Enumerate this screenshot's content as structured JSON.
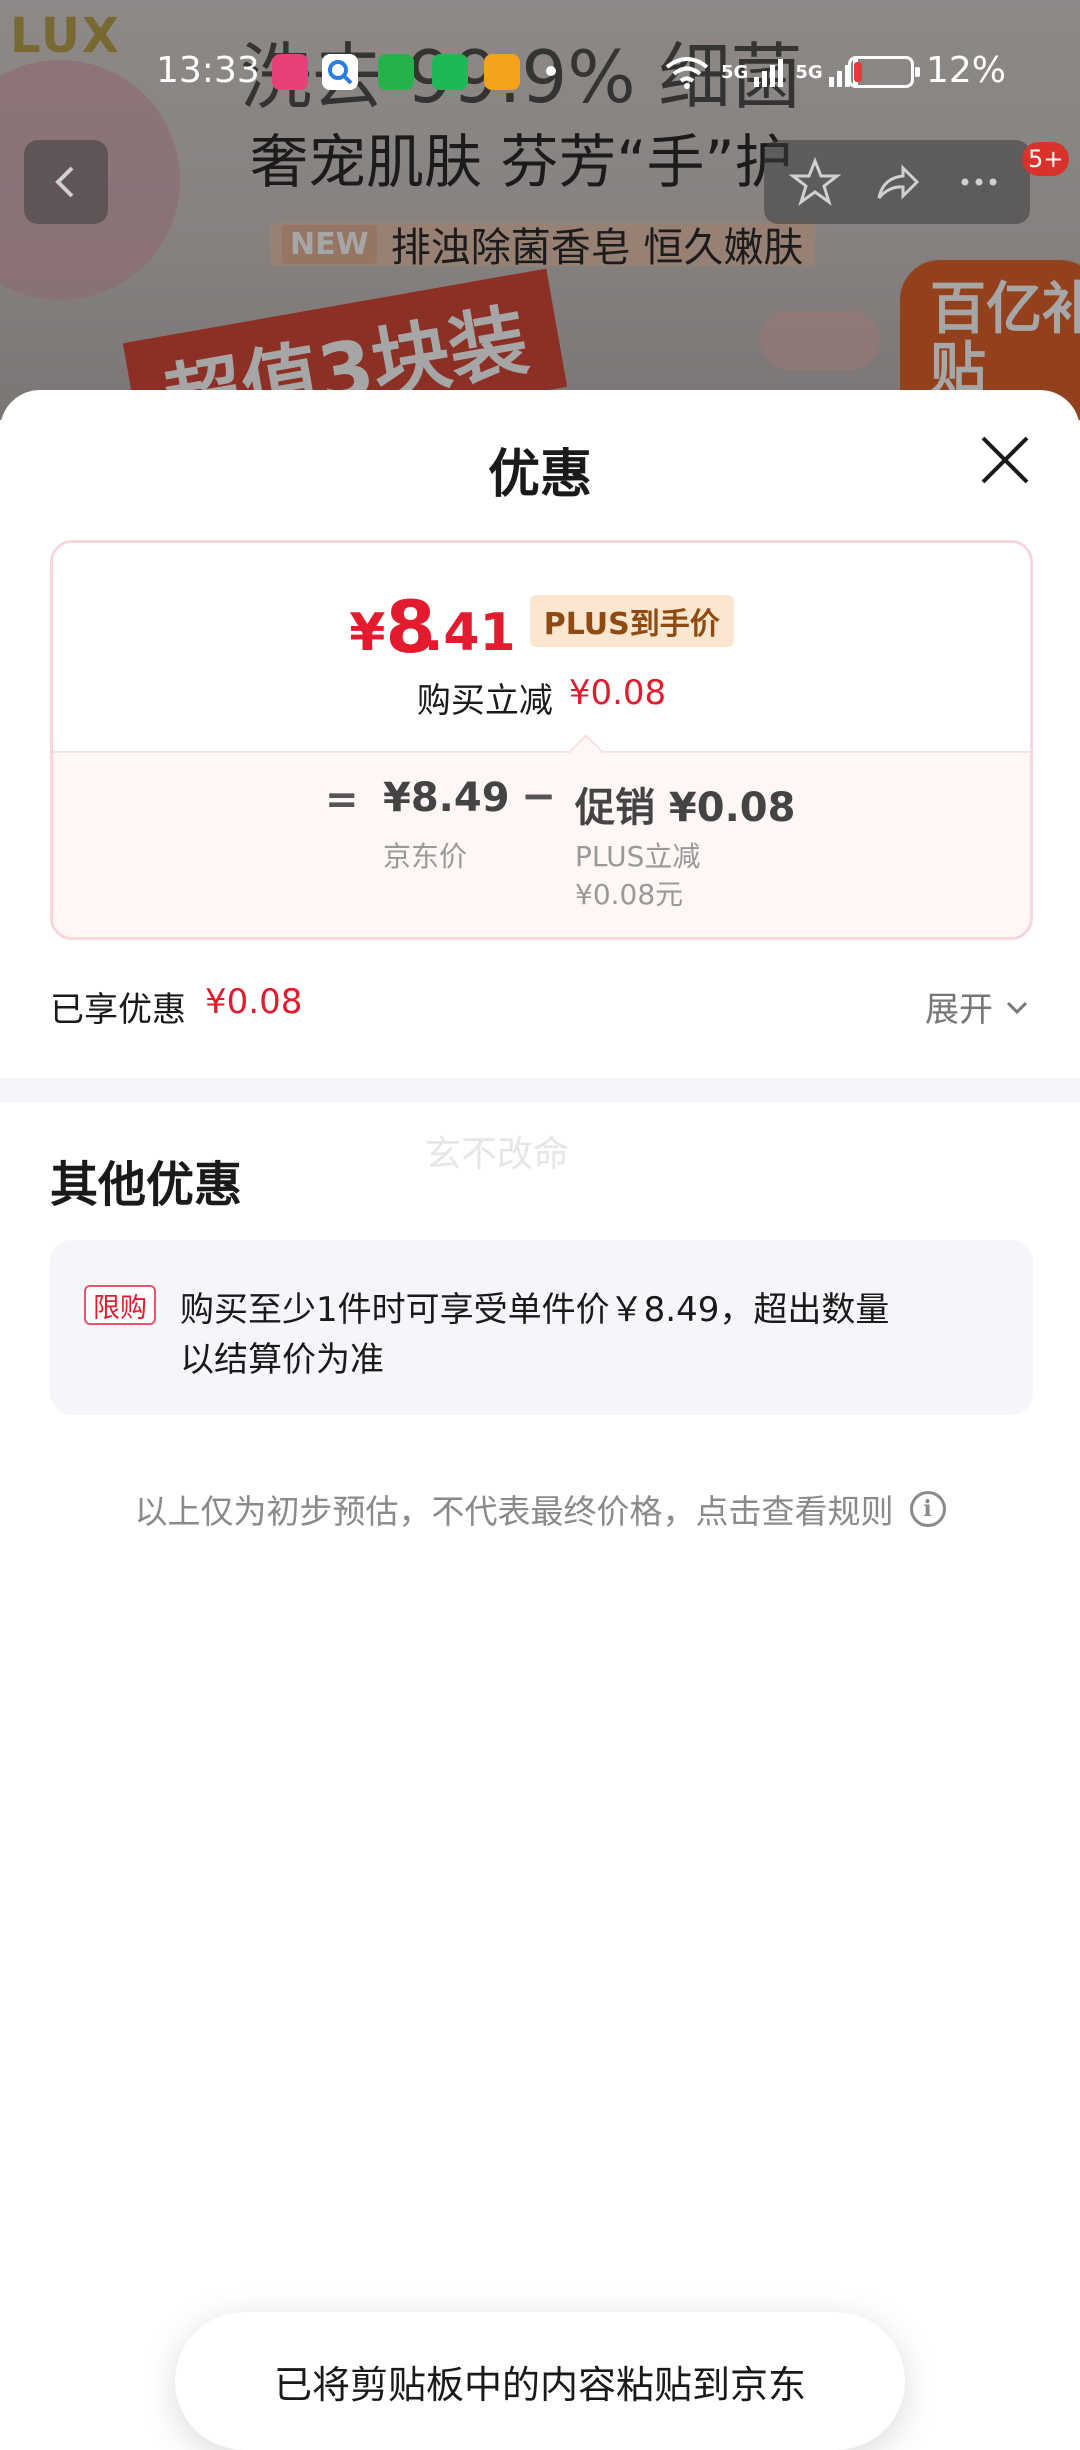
{
  "status_bar": {
    "time": "13:33",
    "battery_percent": "12%",
    "battery_level": 0.12,
    "network_1": "5G",
    "network_2": "5G"
  },
  "banner": {
    "brand": "LUX",
    "headline_line1": "洗去 99.9% 细菌",
    "headline_line2": "奢宠肌肤 芬芳“手”护",
    "new_tag": "NEW",
    "new_text": "排浊除菌香皂 恒久嫩肤",
    "pack_tag": "超值3块装",
    "corner_tag": "百亿补贴",
    "message_badge": "5+"
  },
  "sheet": {
    "title": "优惠",
    "price_card": {
      "currency": "¥",
      "price_int": "8",
      "price_dec": ".41",
      "plus_badge": "PLUS到手价",
      "reduce_label": "购买立减",
      "reduce_value": "¥0.08",
      "equals": "=",
      "jd_price": "¥8.49",
      "jd_label": "京东价",
      "minus": "−",
      "promo_line": "促销 ¥0.08",
      "promo_sub1": "PLUS立减",
      "promo_sub2": "¥0.08元"
    },
    "enjoyed_label": "已享优惠",
    "enjoyed_value": "¥0.08",
    "expand_label": "展开",
    "watermark": "玄不改命",
    "other_title": "其他优惠",
    "offer": {
      "tag": "限购",
      "text_line1": "购买至少1件时可享受单件价￥8.49，超出数量",
      "text_line2": "以结算价为准"
    },
    "disclaimer": "以上仅为初步预估，不代表最终价格，点击查看规则"
  },
  "toast": "已将剪贴板中的内容粘贴到京东",
  "colors": {
    "accent_red": "#e31b2e",
    "plus_badge_bg": "#fbe6cf",
    "plus_badge_text": "#8f4a12",
    "card_border": "#f8d6dc"
  }
}
